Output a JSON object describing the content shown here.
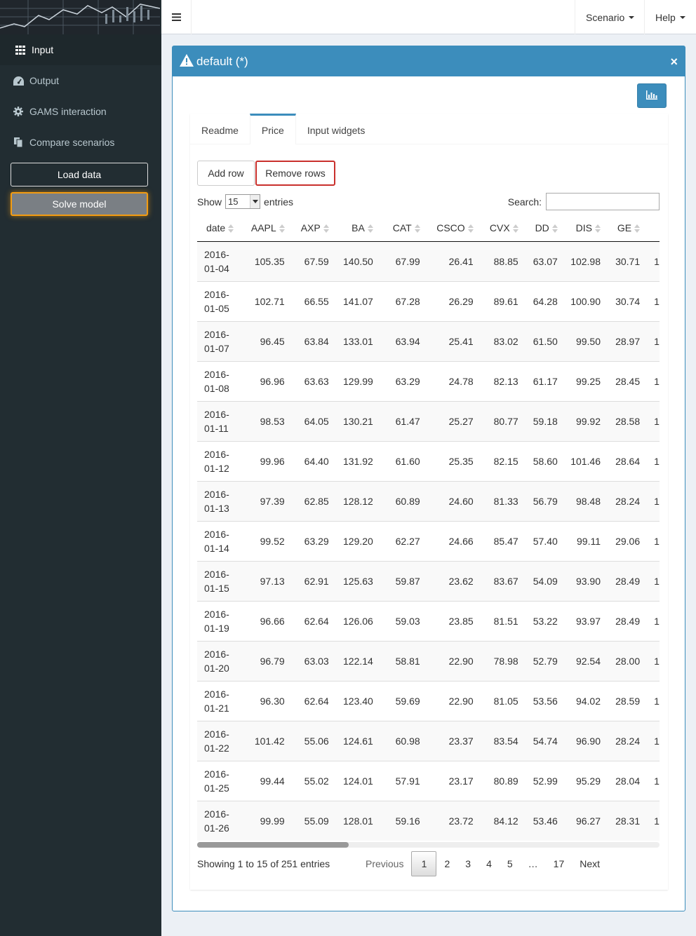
{
  "sidebar": {
    "items": [
      {
        "label": "Input",
        "icon": "table-icon",
        "active": true
      },
      {
        "label": "Output",
        "icon": "dashboard-icon"
      },
      {
        "label": "GAMS interaction",
        "icon": "gear-icon"
      },
      {
        "label": "Compare scenarios",
        "icon": "copy-icon"
      }
    ],
    "load_label": "Load data",
    "solve_label": "Solve model"
  },
  "header": {
    "scenario_label": "Scenario",
    "help_label": "Help"
  },
  "box": {
    "title": "default (*)",
    "close": "×",
    "accent": "#3c8dbc"
  },
  "tabs": [
    {
      "label": "Readme"
    },
    {
      "label": "Price",
      "active": true
    },
    {
      "label": "Input widgets"
    }
  ],
  "toolbar": {
    "add_row": "Add row",
    "remove_rows": "Remove rows"
  },
  "table_controls": {
    "show_label": "Show",
    "entries_value": "15",
    "entries_label": "entries",
    "search_label": "Search:"
  },
  "table": {
    "columns": [
      "date",
      "AAPL",
      "AXP",
      "BA",
      "CAT",
      "CSCO",
      "CVX",
      "DD",
      "DIS",
      "GE"
    ],
    "rows": [
      {
        "date": [
          "2016-",
          "01-04"
        ],
        "values": [
          "105.35",
          "67.59",
          "140.50",
          "67.99",
          "26.41",
          "88.85",
          "63.07",
          "102.98",
          "30.71"
        ]
      },
      {
        "date": [
          "2016-",
          "01-05"
        ],
        "values": [
          "102.71",
          "66.55",
          "141.07",
          "67.28",
          "26.29",
          "89.61",
          "64.28",
          "100.90",
          "30.74"
        ]
      },
      {
        "date": [
          "2016-",
          "01-07"
        ],
        "values": [
          "96.45",
          "63.84",
          "133.01",
          "63.94",
          "25.41",
          "83.02",
          "61.50",
          "99.50",
          "28.97"
        ]
      },
      {
        "date": [
          "2016-",
          "01-08"
        ],
        "values": [
          "96.96",
          "63.63",
          "129.99",
          "63.29",
          "24.78",
          "82.13",
          "61.17",
          "99.25",
          "28.45"
        ]
      },
      {
        "date": [
          "2016-",
          "01-11"
        ],
        "values": [
          "98.53",
          "64.05",
          "130.21",
          "61.47",
          "25.27",
          "80.77",
          "59.18",
          "99.92",
          "28.58"
        ]
      },
      {
        "date": [
          "2016-",
          "01-12"
        ],
        "values": [
          "99.96",
          "64.40",
          "131.92",
          "61.60",
          "25.35",
          "82.15",
          "58.60",
          "101.46",
          "28.64"
        ]
      },
      {
        "date": [
          "2016-",
          "01-13"
        ],
        "values": [
          "97.39",
          "62.85",
          "128.12",
          "60.89",
          "24.60",
          "81.33",
          "56.79",
          "98.48",
          "28.24"
        ]
      },
      {
        "date": [
          "2016-",
          "01-14"
        ],
        "values": [
          "99.52",
          "63.29",
          "129.20",
          "62.27",
          "24.66",
          "85.47",
          "57.40",
          "99.11",
          "29.06"
        ]
      },
      {
        "date": [
          "2016-",
          "01-15"
        ],
        "values": [
          "97.13",
          "62.91",
          "125.63",
          "59.87",
          "23.62",
          "83.67",
          "54.09",
          "93.90",
          "28.49"
        ]
      },
      {
        "date": [
          "2016-",
          "01-19"
        ],
        "values": [
          "96.66",
          "62.64",
          "126.06",
          "59.03",
          "23.85",
          "81.51",
          "53.22",
          "93.97",
          "28.49"
        ]
      },
      {
        "date": [
          "2016-",
          "01-20"
        ],
        "values": [
          "96.79",
          "63.03",
          "122.14",
          "58.81",
          "22.90",
          "78.98",
          "52.79",
          "92.54",
          "28.00"
        ]
      },
      {
        "date": [
          "2016-",
          "01-21"
        ],
        "values": [
          "96.30",
          "62.64",
          "123.40",
          "59.69",
          "22.90",
          "81.05",
          "53.56",
          "94.02",
          "28.59"
        ]
      },
      {
        "date": [
          "2016-",
          "01-22"
        ],
        "values": [
          "101.42",
          "55.06",
          "124.61",
          "60.98",
          "23.37",
          "83.54",
          "54.74",
          "96.90",
          "28.24"
        ]
      },
      {
        "date": [
          "2016-",
          "01-25"
        ],
        "values": [
          "99.44",
          "55.02",
          "124.01",
          "57.91",
          "23.17",
          "80.89",
          "52.99",
          "95.29",
          "28.04"
        ]
      },
      {
        "date": [
          "2016-",
          "01-26"
        ],
        "values": [
          "99.99",
          "55.09",
          "128.01",
          "59.16",
          "23.72",
          "84.12",
          "53.46",
          "96.27",
          "28.31"
        ]
      }
    ],
    "overflow_glyph": "1"
  },
  "footer": {
    "info": "Showing 1 to 15 of 251 entries",
    "pages": [
      "Previous",
      "1",
      "2",
      "3",
      "4",
      "5",
      "…",
      "17",
      "Next"
    ],
    "current_page": "1"
  }
}
